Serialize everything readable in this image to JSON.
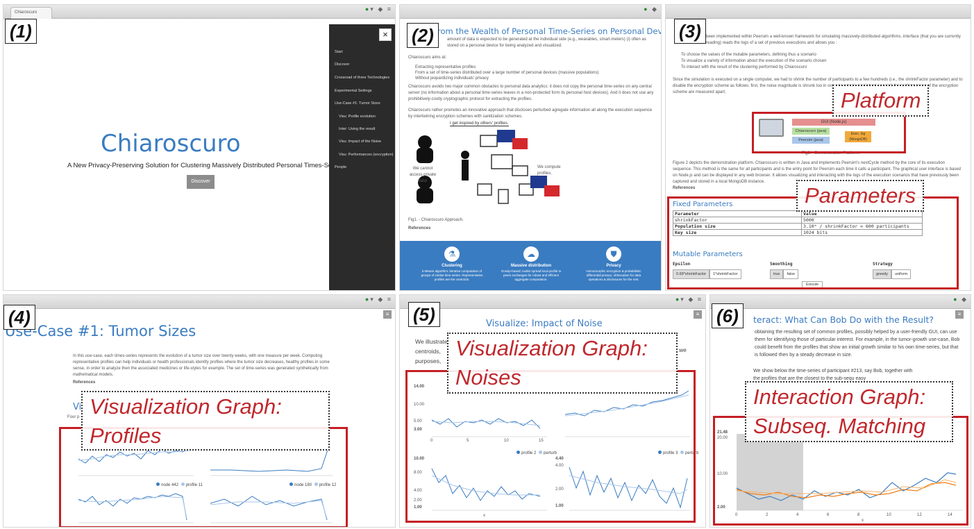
{
  "panels": {
    "p1": {
      "number": "(1)",
      "tab": "Chiaroscuro",
      "title": "Chiaroscuro",
      "subtitle": "A New Privacy-Preserving Solution for Clustering Massively Distributed Personal Times-Series",
      "discover": "Discover",
      "close": "×",
      "menu": [
        "Start",
        "Discover",
        "Crossroad of three Technologies",
        "Experimental Settings",
        "Use-Case #1: Tumor Sizes",
        "Visu: Profile evolution",
        "Inter: Using the result",
        "Visu: Impact of the Noise",
        "Visu: Performances (encryption)",
        "People"
      ]
    },
    "p2": {
      "number": "(2)",
      "title": "from the Wealth of Personal Time-Series on Personal Devices",
      "para1": "amount of data is expected to be generated at the individual side (e.g., wearables, smart-meters) (i) often as stored on a personal device for being analyzed and visualized.",
      "aims": "Chiaroscuro aims at:",
      "bullets": [
        "Extracting representative profiles",
        "From a set of time-series distributed over a large number of personal devices (massive populations)",
        "Without jeopardizing individuals' privacy"
      ],
      "para2": "Chiaroscuro avoids two major common obstacles to personal data analytics: it does not copy the personal time-series on any central server (no information about a personal time-series leaves in a non-protected form its personal host devices). And it does not use any prohibitively-costly cryptographic protocol for extracting the profiles.",
      "para3": "Chiaroscuro rather promotes an innovative approach that discloses perturbed agregate information all along the execution sequence by intertwining encryption schemes with sanitization schemes.",
      "fig_top": "I get inspired by others' profiles.",
      "fig_left": "We cannot access private data!",
      "fig_right": "We compute profiles.",
      "caption": "Fig1. - Chiaroscuro Approach.",
      "refs": "References",
      "features": [
        {
          "label": "Clustering",
          "desc": "k-Means algorithm: iterative computation of groups of similar time-series. Representative profiles are the centroids."
        },
        {
          "label": "Massive distribution",
          "desc": "Gossip-based: nodes spread local profile to peers exchanges for robust and efficient aggregate computation."
        },
        {
          "label": "Privacy",
          "desc": "Homomorphic encryption & probabilistic differential privacy: obfuscation for data operations & disclosures for the rest."
        }
      ]
    },
    "p3": {
      "number": "(3)",
      "intro": "been implemented within Peersim a well-known framework for simulating massively-distributed algorithms. interface (that you are currently reading) reads the logs of a set of previous executions and allows you :",
      "steps": [
        "To choose the values of the mutable parameters, defining thus a scenario",
        "To visualize a variety of information about the execution of the scenario chosen",
        "To interact with the result of the clustering performed by Chiaroscuro"
      ],
      "para": "Since the simulation is executed on a single computer, we had to shrink the number of participants to a few hundreds (i.e., the shrinkFactor parameter) and to disable the encryption scheme as follows: first, the noise magnitude is shrunk too in order to remain consistent; second, the performances of the encryption scheme are measured apart.",
      "platform_callout": "Platform",
      "arch": [
        "GUI (Node.js)",
        "Chiaroscuro (java)",
        "Peersim (java)",
        "Exec. log (MongoDB)"
      ],
      "fig_caption": "Fig2. - Demonstration Platform.",
      "para_bottom": "Figure 2 depicts the demonstration platform. Chiaroscuro is written in Java and implements Peersim's nextCycle method by the core of its execution sequence. This method is the same for all participants and is the entry point for Peersim each time it calls a participant. The graphical user interface is based on Node.js and can be displayed in any web browser. It allows visualizing and interacting with the logs of the execution scenarios that have previously been captured and stored in a local MongoDB instance.",
      "refs": "References",
      "params_callout": "Parameters",
      "fixed_title": "Fixed Parameters",
      "table_head": [
        "Parameter",
        "Value"
      ],
      "table_rows": [
        [
          "shrinkFactor",
          "5000"
        ],
        [
          "Population size",
          "3.10⁶ / shrinkFactor = 600 participants"
        ],
        [
          "Key size",
          "1024 bits"
        ]
      ],
      "mutable_title": "Mutable Parameters",
      "groups": [
        {
          "label": "Epsilon",
          "opts": [
            "0.69*shrinkFactor",
            "1*shrinkFactor"
          ]
        },
        {
          "label": "Smoothing",
          "opts": [
            "true",
            "false"
          ]
        },
        {
          "label": "Strategy",
          "opts": [
            "greedy",
            "uniform"
          ]
        }
      ],
      "button": "Execute"
    },
    "p4": {
      "number": "(4)",
      "title": "Use-Case #1: Tumor Sizes",
      "para": "In this use-case, each times-series represents the evolution of a tumor size over twenty weeks, with one measure per week. Computing representative profiles can help individuals or health professionals identify profiles where the tumor size decreases, healthy profiles in some sense, in order to analyze then the associated medicines or life-styles for example. The set of time-series was generated synthetically from mathematical models.",
      "refs": "References",
      "subhead": "Vi",
      "subtext": "Four p",
      "callout": "Visualization Graph:\nProfiles",
      "legend": [
        "node 442",
        "profile 11",
        "node 180",
        "profile 12"
      ]
    },
    "p5": {
      "number": "(5)",
      "title": "Visualize: Impact of Noise",
      "text": "We illustrate centroids, purposes,",
      "text_right": "we",
      "callout": "Visualization Graph:\nNoises",
      "legend": [
        "profile 2",
        "perturb",
        "profile 3",
        "perturb"
      ],
      "axis_x": "x",
      "ticks_x": [
        "0",
        "5",
        "10",
        "15"
      ],
      "ticks_tl": [
        "14.00",
        "10.00",
        "5.00",
        "3.00"
      ],
      "ticks_bl": [
        "10.00",
        "8.00",
        "4.00",
        "2.00",
        "1.00"
      ],
      "ticks_br": [
        "4.40",
        "4.00",
        "2.00",
        "1.00"
      ]
    },
    "p6": {
      "number": "(6)",
      "title": "teract: What Can Bob Do with the Result?",
      "para1": "obtaining the resulting set of common profiles, possibly helped by a user-friendly GUI, can use them for identifying those of particular interest. For example, in the tumor-growth use-case, Bob could benefit from the profiles that show an initial growth similar to his own time-series, but that is followed then by a steady decrease in size.",
      "para2": "We show below the time-series of participant #213, say Bob, together with the profiles that are the closest to the sub-sequ easy",
      "callout": "Interaction Graph:\nSubseq. Matching",
      "ticks_y": [
        "21.48",
        "20.00",
        "10.00",
        "2.00"
      ],
      "ticks_x": [
        "0",
        "2",
        "4",
        "6",
        "8",
        "10",
        "12",
        "14"
      ],
      "axis_x": "x"
    }
  },
  "colors": {
    "accent": "#3a7cc1",
    "callout_red": "#c51f24",
    "menu_bg": "#2b2b2b"
  }
}
